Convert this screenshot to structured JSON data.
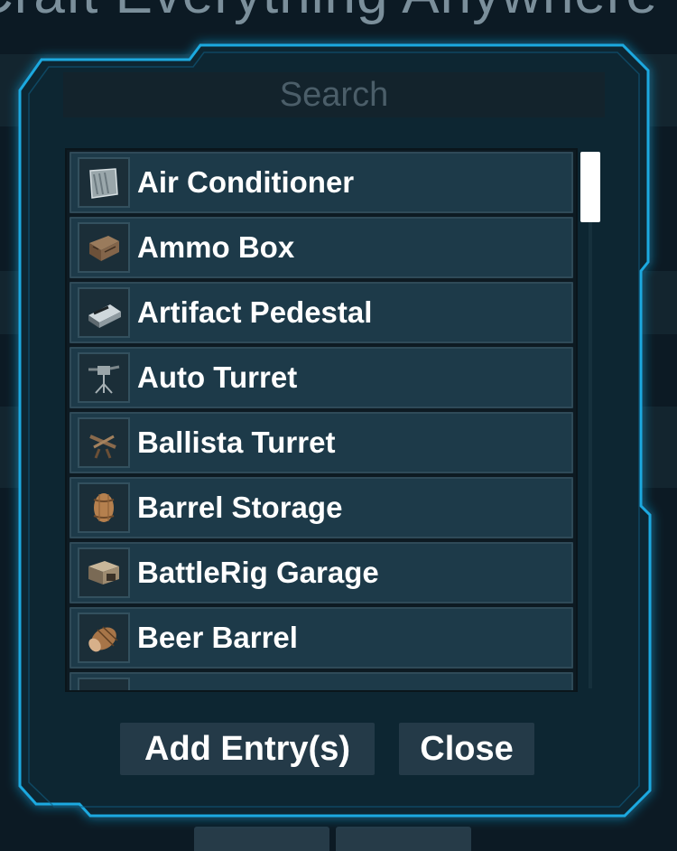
{
  "background": {
    "title": "Craft Everything Anywhere"
  },
  "search": {
    "placeholder": "Search"
  },
  "items": [
    {
      "label": "Air Conditioner",
      "icon": "air-conditioner-icon"
    },
    {
      "label": "Ammo Box",
      "icon": "ammo-box-icon"
    },
    {
      "label": "Artifact Pedestal",
      "icon": "artifact-pedestal-icon"
    },
    {
      "label": "Auto Turret",
      "icon": "auto-turret-icon"
    },
    {
      "label": "Ballista Turret",
      "icon": "ballista-turret-icon"
    },
    {
      "label": "Barrel Storage",
      "icon": "barrel-storage-icon"
    },
    {
      "label": "BattleRig Garage",
      "icon": "battlerig-garage-icon"
    },
    {
      "label": "Beer Barrel",
      "icon": "beer-barrel-icon"
    }
  ],
  "buttons": {
    "add_label": "Add Entry(s)",
    "close_label": "Close"
  },
  "colors": {
    "frame_accent": "#1aa9e0",
    "panel": "#0f2532",
    "row": "#1d3a49",
    "button": "#243a48"
  }
}
